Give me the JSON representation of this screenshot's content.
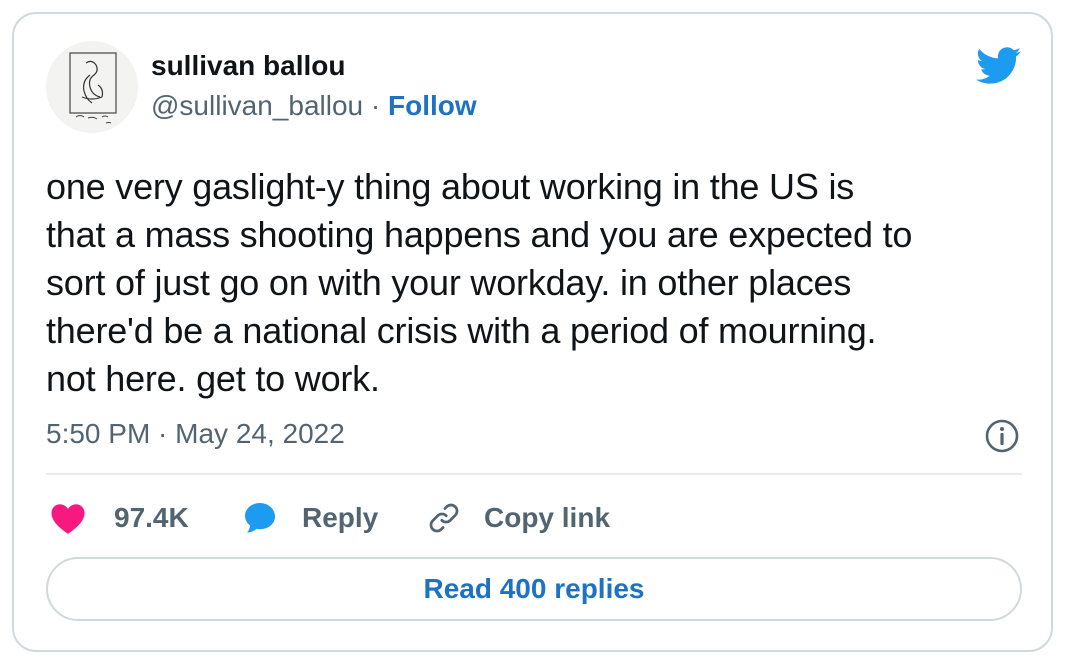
{
  "colors": {
    "brand_blue": "#1d9bf0",
    "link_blue": "#1d72c4",
    "like_pink": "#f91880",
    "text_primary": "#0f1419",
    "text_secondary": "#536471",
    "border": "#cfd9de"
  },
  "author": {
    "display_name": "sullivan ballou",
    "handle": "@sullivan_ballou",
    "separator": " · ",
    "follow_label": "Follow",
    "avatar_icon": "sketch-avatar"
  },
  "tweet": {
    "text": "one very gaslight-y thing about working in the US is\nthat a mass shooting happens and you are expected to\nsort of just go on with your workday. in other places\nthere'd be a national crisis with a period of mourning.\nnot here. get to work.",
    "timestamp": "5:50 PM · May 24, 2022"
  },
  "actions": {
    "like_count": "97.4K",
    "reply_label": "Reply",
    "copy_link_label": "Copy link"
  },
  "footer": {
    "read_replies_label": "Read 400 replies"
  },
  "icons": {
    "brand": "twitter-bird-icon",
    "info": "info-icon",
    "like": "heart-icon",
    "reply": "speech-bubble-icon",
    "copy": "link-icon"
  }
}
